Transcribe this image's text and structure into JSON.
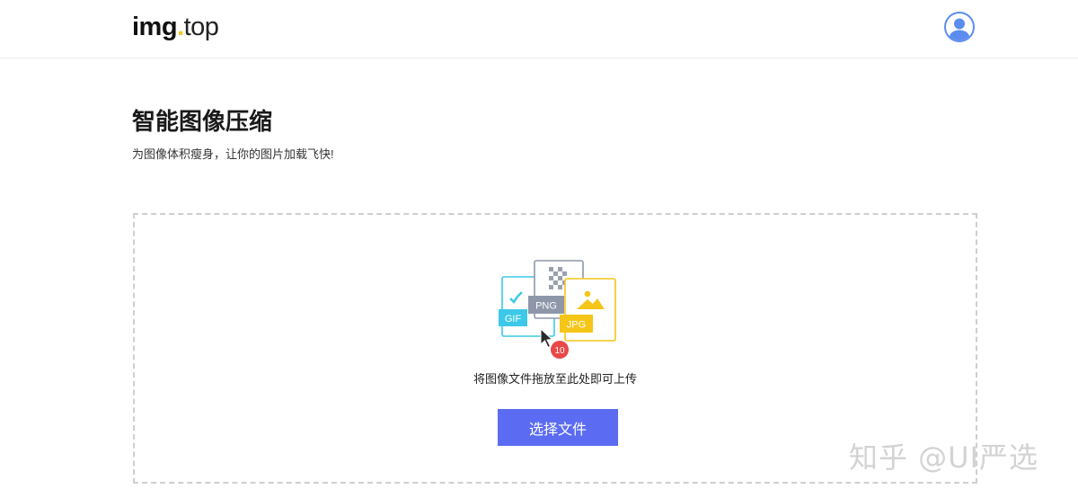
{
  "header": {
    "logo": {
      "brand": "img",
      "dot": ".",
      "tld": "top"
    },
    "avatar_icon": "user-avatar-icon"
  },
  "main": {
    "title": "智能图像压缩",
    "subtitle": "为图像体积瘦身，让你的图片加载飞快!"
  },
  "dropzone": {
    "illustration": {
      "gif_label": "GIF",
      "png_label": "PNG",
      "jpg_label": "JPG",
      "count_badge": "10"
    },
    "hint": "将图像文件拖放至此处即可上传",
    "choose_button": "选择文件"
  },
  "watermark": "知乎 @UI严选",
  "colors": {
    "accent": "#5b6cf2",
    "logo_dot": "#f5c518",
    "gif": "#3cc8e8",
    "png": "#8e97aa",
    "jpg": "#f5c518",
    "badge": "#e84848"
  }
}
